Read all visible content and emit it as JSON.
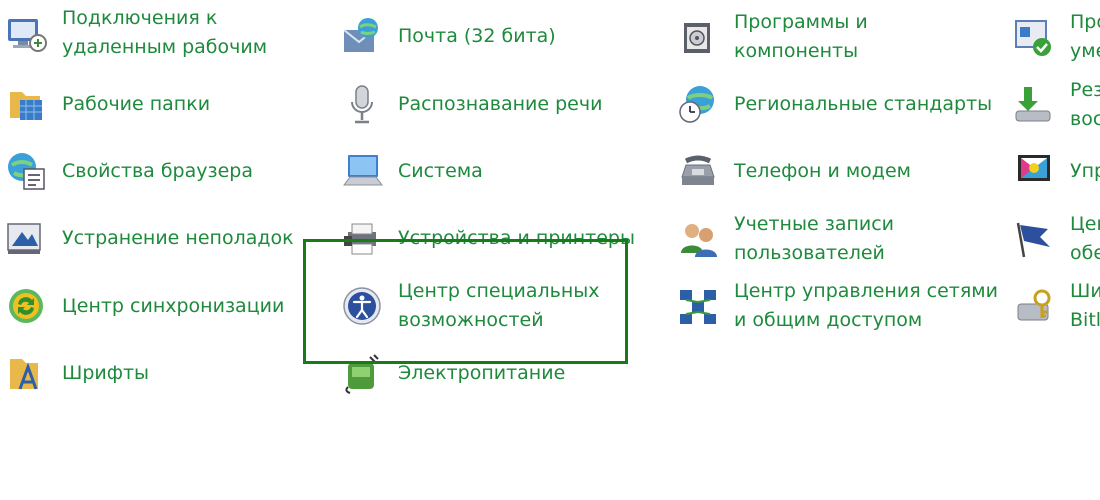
{
  "highlight_color": "#187a18",
  "link_color": "#1e8a3c",
  "items": [
    {
      "id": "remote-desktop",
      "line1": "Подключения к",
      "line2": "удаленным рабочим",
      "icon": "remote-desktop-icon"
    },
    {
      "id": "work-folders",
      "line1": "Рабочие папки",
      "line2": "",
      "icon": "work-folders-icon"
    },
    {
      "id": "browser",
      "line1": "Свойства браузера",
      "line2": "",
      "icon": "browser-properties-icon"
    },
    {
      "id": "troubleshoot",
      "line1": "Устранение неполадок",
      "line2": "",
      "icon": "troubleshooting-icon"
    },
    {
      "id": "sync",
      "line1": "Центр синхронизации",
      "line2": "",
      "icon": "sync-center-icon"
    },
    {
      "id": "fonts",
      "line1": "Шрифты",
      "line2": "",
      "icon": "fonts-icon"
    },
    {
      "id": "mail",
      "line1": "Почта (32 бита)",
      "line2": "",
      "icon": "mail-icon"
    },
    {
      "id": "speech",
      "line1": "Распознавание речи",
      "line2": "",
      "icon": "microphone-icon"
    },
    {
      "id": "system",
      "line1": "Система",
      "line2": "",
      "icon": "system-icon"
    },
    {
      "id": "devices",
      "line1": "Устройства и принтеры",
      "line2": "",
      "icon": "printer-icon"
    },
    {
      "id": "accessibility",
      "line1": "Центр специальных",
      "line2": "возможностей",
      "icon": "ease-of-access-icon"
    },
    {
      "id": "power",
      "line1": "Электропитание",
      "line2": "",
      "icon": "power-options-icon"
    },
    {
      "id": "programs",
      "line1": "Программы и",
      "line2": "компоненты",
      "icon": "programs-icon"
    },
    {
      "id": "region",
      "line1": "Региональные стандарты",
      "line2": "",
      "icon": "region-clock-icon"
    },
    {
      "id": "phone",
      "line1": "Телефон и модем",
      "line2": "",
      "icon": "phone-modem-icon"
    },
    {
      "id": "accounts",
      "line1": "Учетные записи",
      "line2": "пользователей",
      "icon": "user-accounts-icon"
    },
    {
      "id": "network",
      "line1": "Центр управления сетями",
      "line2": "и общим доступом",
      "icon": "network-center-icon"
    },
    {
      "id": "c4-1",
      "line1": "Про",
      "line2": "уме",
      "icon": "default-programs-icon"
    },
    {
      "id": "c4-2",
      "line1": "Рез",
      "line2": "вос",
      "icon": "backup-restore-icon"
    },
    {
      "id": "c4-3",
      "line1": "Упр",
      "line2": "",
      "icon": "color-management-icon"
    },
    {
      "id": "c4-4",
      "line1": "Цен",
      "line2": "обе",
      "icon": "flag-icon"
    },
    {
      "id": "c4-5",
      "line1": "Ши",
      "line2": "Bitl",
      "icon": "bitlocker-icon"
    }
  ]
}
